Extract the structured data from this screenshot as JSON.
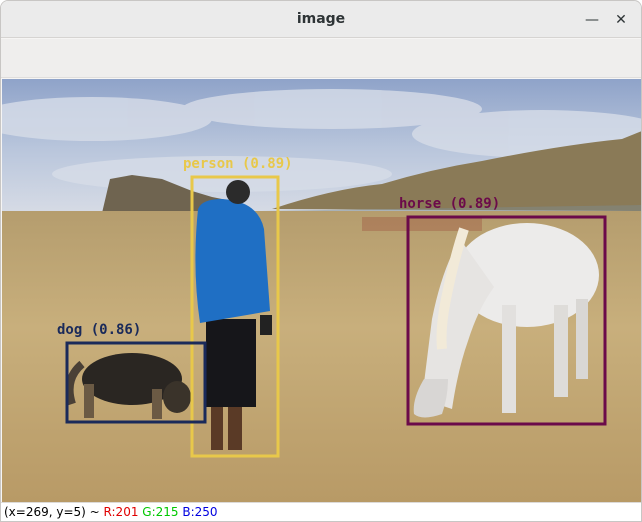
{
  "window": {
    "title": "image",
    "minimize_glyph": "—",
    "close_glyph": "✕"
  },
  "detections": [
    {
      "label": "person (0.89)",
      "color": "#e8c84a"
    },
    {
      "label": "horse (0.89)",
      "color": "#6b0a4a"
    },
    {
      "label": "dog (0.86)",
      "color": "#1a2a5a"
    }
  ],
  "status": {
    "coords": "(x=269, y=5) ~",
    "r": "R:201",
    "g": "G:215",
    "b": "B:250"
  }
}
